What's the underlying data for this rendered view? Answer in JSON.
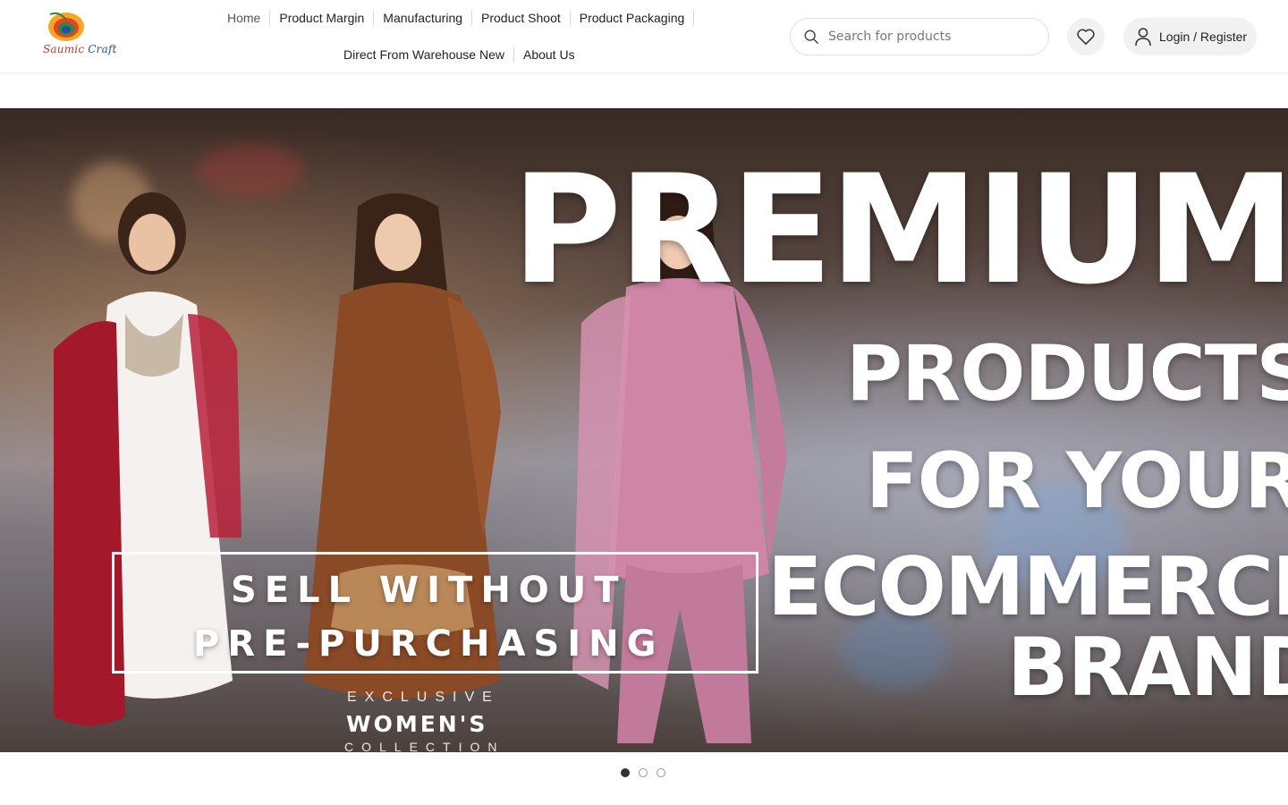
{
  "brand": {
    "logo_text_1": "Saumic",
    "logo_text_2": "Craft",
    "logo_icon": "peacock-feather-icon"
  },
  "nav": {
    "row1": [
      "Home",
      "Product Margin",
      "Manufacturing",
      "Product Shoot",
      "Product Packaging"
    ],
    "row2": [
      "Direct From Warehouse New",
      "About Us"
    ]
  },
  "search": {
    "placeholder": "Search for products",
    "value": "",
    "icon": "search-icon"
  },
  "header_actions": {
    "wishlist_icon": "heart-icon",
    "login_label": "Login / Register",
    "login_icon": "user-icon"
  },
  "hero": {
    "headline_1": "PREMIUM",
    "headline_2": "PRODUCTS",
    "headline_3": "FOR YOUR",
    "headline_4": "ECOMMERCE",
    "headline_5": "BRAND",
    "box_line_1": "SELL WITHOUT",
    "box_line_2": "PRE-PURCHASING",
    "exclusive": "EXCLUSIVE",
    "womens": "WOMEN'S",
    "collection": "COLLECTION"
  },
  "slider": {
    "total_slides": 3,
    "active_slide": 1
  },
  "colors": {
    "logo_red": "#c0392b",
    "logo_blue": "#1f4fa0",
    "text": "#222222",
    "pill_bg": "#f1f1f1"
  }
}
